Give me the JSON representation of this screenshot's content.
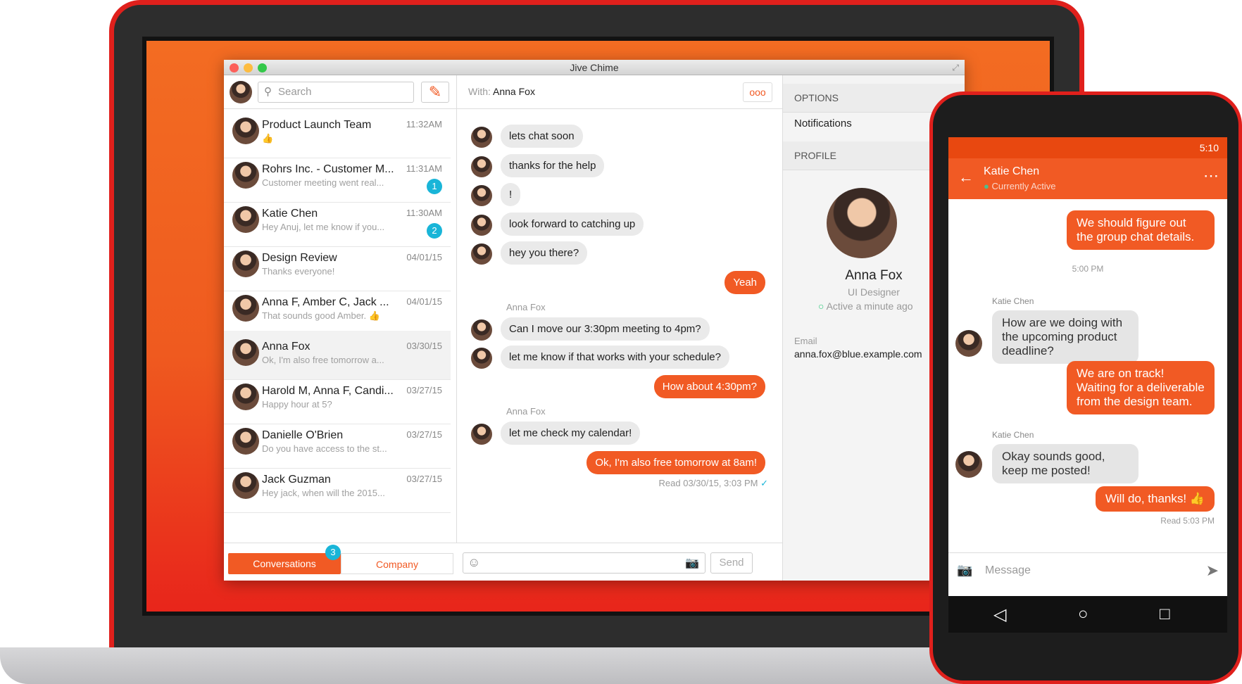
{
  "app": {
    "title": "Jive Chime"
  },
  "sidebar": {
    "search_placeholder": "Search",
    "conversations": [
      {
        "name": "Product Launch Team",
        "preview": "👍",
        "time": "11:32AM",
        "badge": ""
      },
      {
        "name": "Rohrs Inc. - Customer M...",
        "preview": "Customer meeting went real...",
        "time": "11:31AM",
        "badge": "1"
      },
      {
        "name": "Katie Chen",
        "preview": "Hey Anuj, let me know if you...",
        "time": "11:30AM",
        "badge": "2"
      },
      {
        "name": "Design Review",
        "preview": "Thanks everyone!",
        "time": "04/01/15",
        "badge": ""
      },
      {
        "name": "Anna F, Amber C, Jack ...",
        "preview": "That sounds good Amber. 👍",
        "time": "04/01/15",
        "badge": ""
      },
      {
        "name": "Anna Fox",
        "preview": "Ok, I'm also free tomorrow a...",
        "time": "03/30/15",
        "badge": ""
      },
      {
        "name": "Harold M, Anna F, Candi...",
        "preview": "Happy hour at 5?",
        "time": "03/27/15",
        "badge": ""
      },
      {
        "name": "Danielle O'Brien",
        "preview": "Do you have access to the st...",
        "time": "03/27/15",
        "badge": ""
      },
      {
        "name": "Jack Guzman",
        "preview": "Hey jack, when will the 2015...",
        "time": "03/27/15",
        "badge": ""
      }
    ],
    "tab_conversations": "Conversations",
    "tab_company": "Company",
    "tab_badge": "3"
  },
  "chat": {
    "with_label": "With:",
    "with_name": "Anna Fox",
    "more": "ooo",
    "messages": [
      {
        "dir": "in",
        "text": "lets chat soon"
      },
      {
        "dir": "in",
        "text": "thanks for the help"
      },
      {
        "dir": "in",
        "text": "!"
      },
      {
        "dir": "in",
        "text": "look forward to catching up"
      },
      {
        "dir": "in",
        "text": "hey you there?"
      },
      {
        "dir": "out",
        "text": "Yeah"
      },
      {
        "dir": "in",
        "text": "Can I move our 3:30pm meeting to 4pm?"
      },
      {
        "dir": "in",
        "text": "let me know if that works with your schedule?"
      },
      {
        "dir": "out",
        "text": "How about 4:30pm?"
      },
      {
        "dir": "in",
        "text": "let me check my calendar!"
      },
      {
        "dir": "out",
        "text": "Ok, I'm also free tomorrow at 8am!"
      }
    ],
    "sender": "Anna Fox",
    "read": "Read 03/30/15, 3:03 PM",
    "send": "Send"
  },
  "panel": {
    "options": "OPTIONS",
    "notifications": "Notifications",
    "profile": "PROFILE",
    "name": "Anna Fox",
    "role": "UI Designer",
    "status": "Active a minute ago",
    "email_label": "Email",
    "email": "anna.fox@blue.example.com"
  },
  "phone": {
    "time": "5:10",
    "contact": "Katie Chen",
    "status": "Currently Active",
    "m1": "We should figure out the group chat details.",
    "stamp": "5:00 PM",
    "sender": "Katie Chen",
    "m2": "How are we doing with the upcoming product deadline?",
    "m3": "We are on track! Waiting for a deliverable from the design team.",
    "m4": "Okay sounds good, keep me posted!",
    "m5": "Will do, thanks! 👍",
    "read": "Read 5:03 PM",
    "input_placeholder": "Message"
  }
}
